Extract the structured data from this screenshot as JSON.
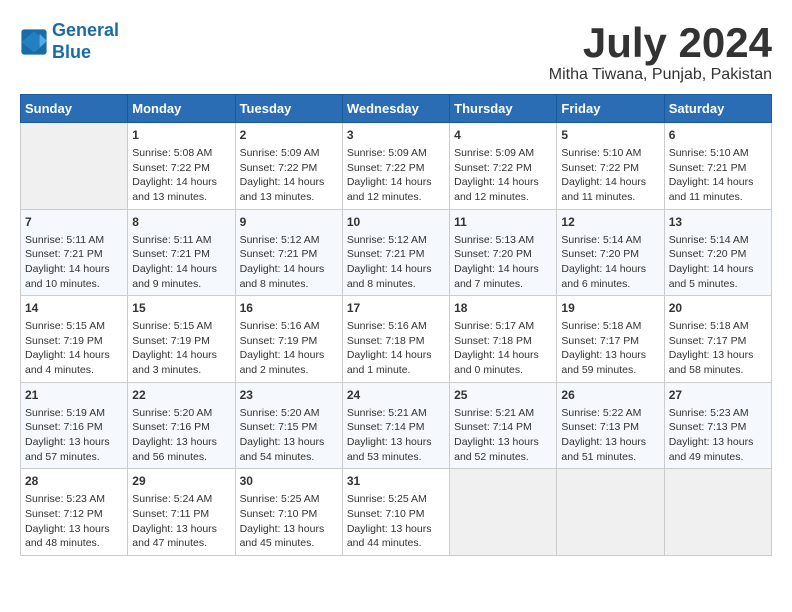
{
  "header": {
    "logo_line1": "General",
    "logo_line2": "Blue",
    "month": "July 2024",
    "location": "Mitha Tiwana, Punjab, Pakistan"
  },
  "weekdays": [
    "Sunday",
    "Monday",
    "Tuesday",
    "Wednesday",
    "Thursday",
    "Friday",
    "Saturday"
  ],
  "weeks": [
    [
      {
        "day": "",
        "empty": true
      },
      {
        "day": "1",
        "sunrise": "5:08 AM",
        "sunset": "7:22 PM",
        "daylight": "14 hours and 13 minutes."
      },
      {
        "day": "2",
        "sunrise": "5:09 AM",
        "sunset": "7:22 PM",
        "daylight": "14 hours and 13 minutes."
      },
      {
        "day": "3",
        "sunrise": "5:09 AM",
        "sunset": "7:22 PM",
        "daylight": "14 hours and 12 minutes."
      },
      {
        "day": "4",
        "sunrise": "5:09 AM",
        "sunset": "7:22 PM",
        "daylight": "14 hours and 12 minutes."
      },
      {
        "day": "5",
        "sunrise": "5:10 AM",
        "sunset": "7:22 PM",
        "daylight": "14 hours and 11 minutes."
      },
      {
        "day": "6",
        "sunrise": "5:10 AM",
        "sunset": "7:21 PM",
        "daylight": "14 hours and 11 minutes."
      }
    ],
    [
      {
        "day": "7",
        "sunrise": "5:11 AM",
        "sunset": "7:21 PM",
        "daylight": "14 hours and 10 minutes."
      },
      {
        "day": "8",
        "sunrise": "5:11 AM",
        "sunset": "7:21 PM",
        "daylight": "14 hours and 9 minutes."
      },
      {
        "day": "9",
        "sunrise": "5:12 AM",
        "sunset": "7:21 PM",
        "daylight": "14 hours and 8 minutes."
      },
      {
        "day": "10",
        "sunrise": "5:12 AM",
        "sunset": "7:21 PM",
        "daylight": "14 hours and 8 minutes."
      },
      {
        "day": "11",
        "sunrise": "5:13 AM",
        "sunset": "7:20 PM",
        "daylight": "14 hours and 7 minutes."
      },
      {
        "day": "12",
        "sunrise": "5:14 AM",
        "sunset": "7:20 PM",
        "daylight": "14 hours and 6 minutes."
      },
      {
        "day": "13",
        "sunrise": "5:14 AM",
        "sunset": "7:20 PM",
        "daylight": "14 hours and 5 minutes."
      }
    ],
    [
      {
        "day": "14",
        "sunrise": "5:15 AM",
        "sunset": "7:19 PM",
        "daylight": "14 hours and 4 minutes."
      },
      {
        "day": "15",
        "sunrise": "5:15 AM",
        "sunset": "7:19 PM",
        "daylight": "14 hours and 3 minutes."
      },
      {
        "day": "16",
        "sunrise": "5:16 AM",
        "sunset": "7:19 PM",
        "daylight": "14 hours and 2 minutes."
      },
      {
        "day": "17",
        "sunrise": "5:16 AM",
        "sunset": "7:18 PM",
        "daylight": "14 hours and 1 minute."
      },
      {
        "day": "18",
        "sunrise": "5:17 AM",
        "sunset": "7:18 PM",
        "daylight": "14 hours and 0 minutes."
      },
      {
        "day": "19",
        "sunrise": "5:18 AM",
        "sunset": "7:17 PM",
        "daylight": "13 hours and 59 minutes."
      },
      {
        "day": "20",
        "sunrise": "5:18 AM",
        "sunset": "7:17 PM",
        "daylight": "13 hours and 58 minutes."
      }
    ],
    [
      {
        "day": "21",
        "sunrise": "5:19 AM",
        "sunset": "7:16 PM",
        "daylight": "13 hours and 57 minutes."
      },
      {
        "day": "22",
        "sunrise": "5:20 AM",
        "sunset": "7:16 PM",
        "daylight": "13 hours and 56 minutes."
      },
      {
        "day": "23",
        "sunrise": "5:20 AM",
        "sunset": "7:15 PM",
        "daylight": "13 hours and 54 minutes."
      },
      {
        "day": "24",
        "sunrise": "5:21 AM",
        "sunset": "7:14 PM",
        "daylight": "13 hours and 53 minutes."
      },
      {
        "day": "25",
        "sunrise": "5:21 AM",
        "sunset": "7:14 PM",
        "daylight": "13 hours and 52 minutes."
      },
      {
        "day": "26",
        "sunrise": "5:22 AM",
        "sunset": "7:13 PM",
        "daylight": "13 hours and 51 minutes."
      },
      {
        "day": "27",
        "sunrise": "5:23 AM",
        "sunset": "7:13 PM",
        "daylight": "13 hours and 49 minutes."
      }
    ],
    [
      {
        "day": "28",
        "sunrise": "5:23 AM",
        "sunset": "7:12 PM",
        "daylight": "13 hours and 48 minutes."
      },
      {
        "day": "29",
        "sunrise": "5:24 AM",
        "sunset": "7:11 PM",
        "daylight": "13 hours and 47 minutes."
      },
      {
        "day": "30",
        "sunrise": "5:25 AM",
        "sunset": "7:10 PM",
        "daylight": "13 hours and 45 minutes."
      },
      {
        "day": "31",
        "sunrise": "5:25 AM",
        "sunset": "7:10 PM",
        "daylight": "13 hours and 44 minutes."
      },
      {
        "day": "",
        "empty": true
      },
      {
        "day": "",
        "empty": true
      },
      {
        "day": "",
        "empty": true
      }
    ]
  ]
}
